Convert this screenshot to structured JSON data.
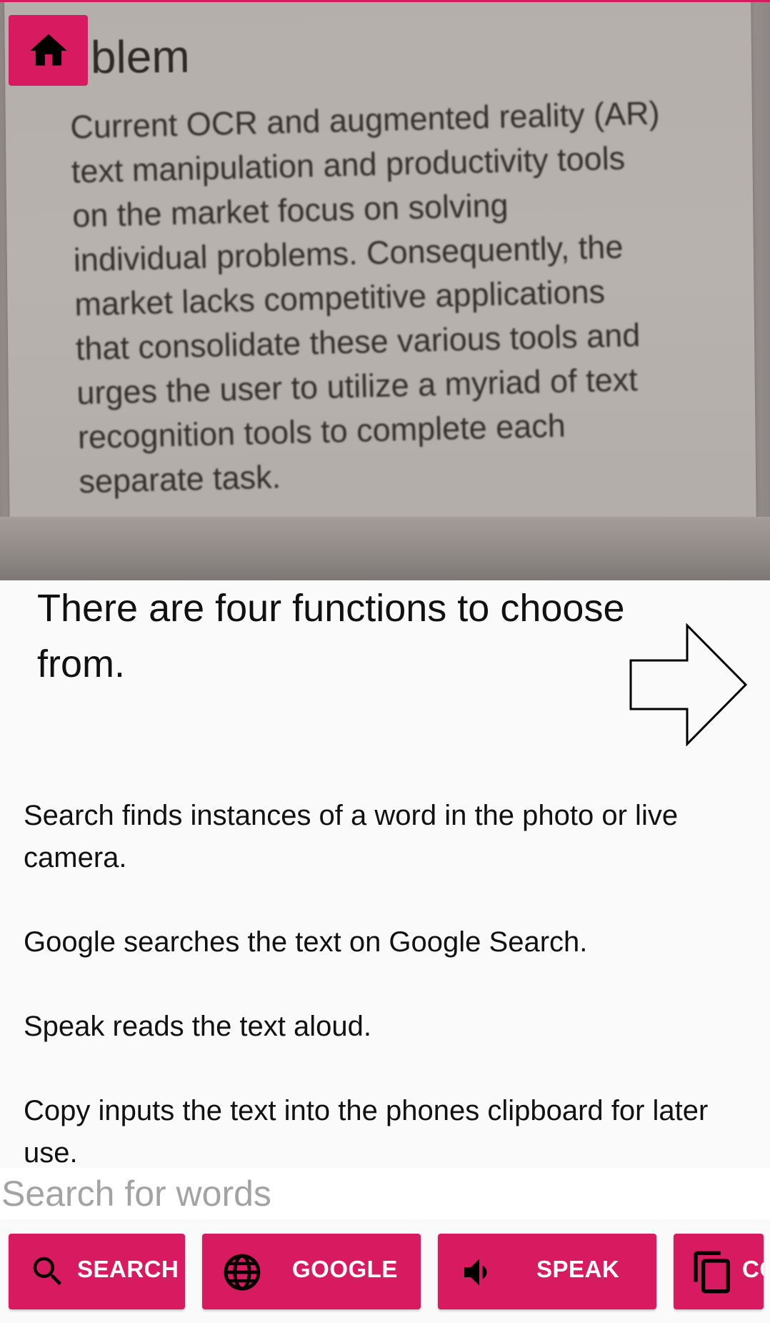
{
  "app": {
    "accent_color": "#d81b60"
  },
  "toolbar": {
    "home_icon": "home-icon"
  },
  "camera_preview": {
    "document_title": "blem",
    "document_lines": [
      "Current OCR and augmented reality (AR)",
      "text manipulation and productivity tools",
      "on the market focus on solving",
      "individual problems.  Consequently, the",
      "market lacks competitive applications",
      "that consolidate these various tools and",
      "urges the user to utilize a myriad of text",
      "recognition tools to complete each",
      "separate task."
    ]
  },
  "tutorial": {
    "heading_line1": "There are four functions to choose",
    "heading_line2": "from.",
    "next_icon": "arrow-right-outline-icon",
    "descriptions": [
      "Search finds instances of a word in the photo or live camera.",
      "Google searches the text on Google Search.",
      "Speak reads the text aloud.",
      "Copy inputs the text into the phones clipboard for later use."
    ]
  },
  "search": {
    "placeholder": "Search for words",
    "value": ""
  },
  "actions": {
    "search_label": "SEARCH",
    "google_label": "GOOGLE",
    "speak_label": "SPEAK",
    "copy_label": "COPY",
    "search_icon": "search-icon",
    "google_icon": "globe-icon",
    "speak_icon": "speaker-icon",
    "copy_icon": "copy-icon"
  }
}
